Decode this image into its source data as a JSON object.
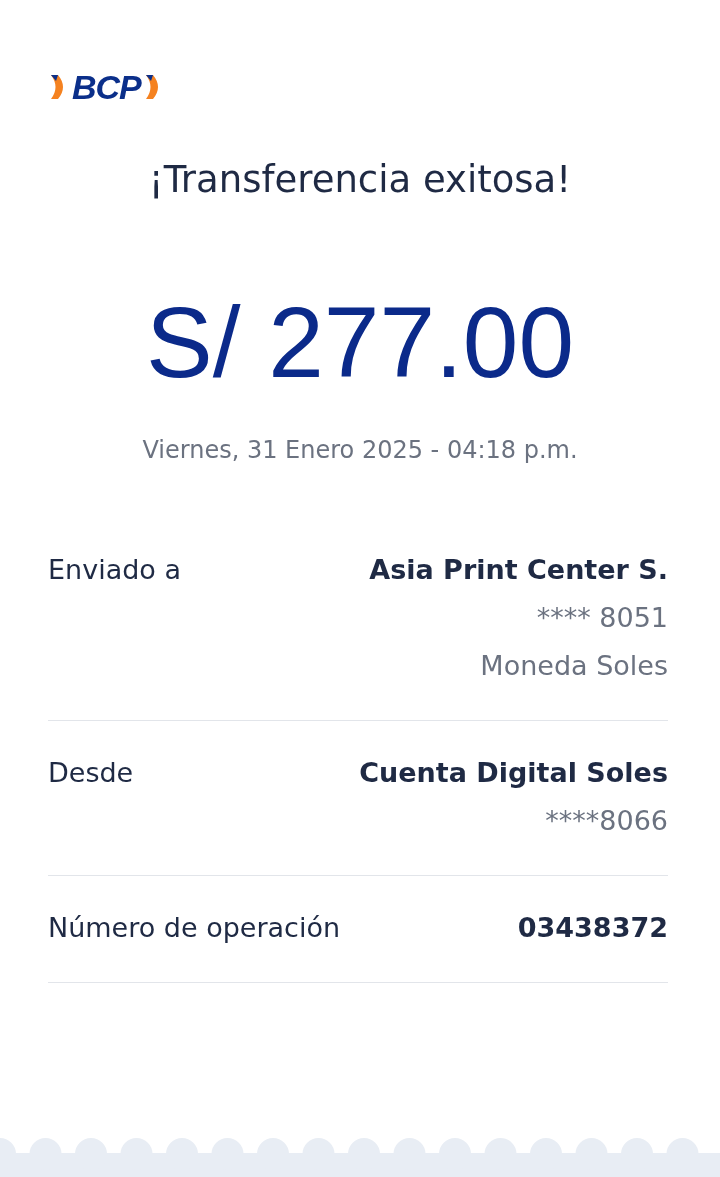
{
  "logo": {
    "text": "BCP"
  },
  "title": "¡Transferencia exitosa!",
  "amount": "S/ 277.00",
  "date": "Viernes, 31 Enero 2025 - 04:18 p.m.",
  "details": [
    {
      "label": "Enviado a",
      "values": [
        {
          "text": "Asia Print Center S.",
          "bold": true
        },
        {
          "text": "**** 8051",
          "bold": false
        },
        {
          "text": "Moneda Soles",
          "bold": false
        }
      ]
    },
    {
      "label": "Desde",
      "values": [
        {
          "text": "Cuenta Digital Soles",
          "bold": true
        },
        {
          "text": "****8066",
          "bold": false
        }
      ]
    },
    {
      "label": "Número de operación",
      "values": [
        {
          "text": "03438372",
          "bold": true
        }
      ]
    }
  ]
}
